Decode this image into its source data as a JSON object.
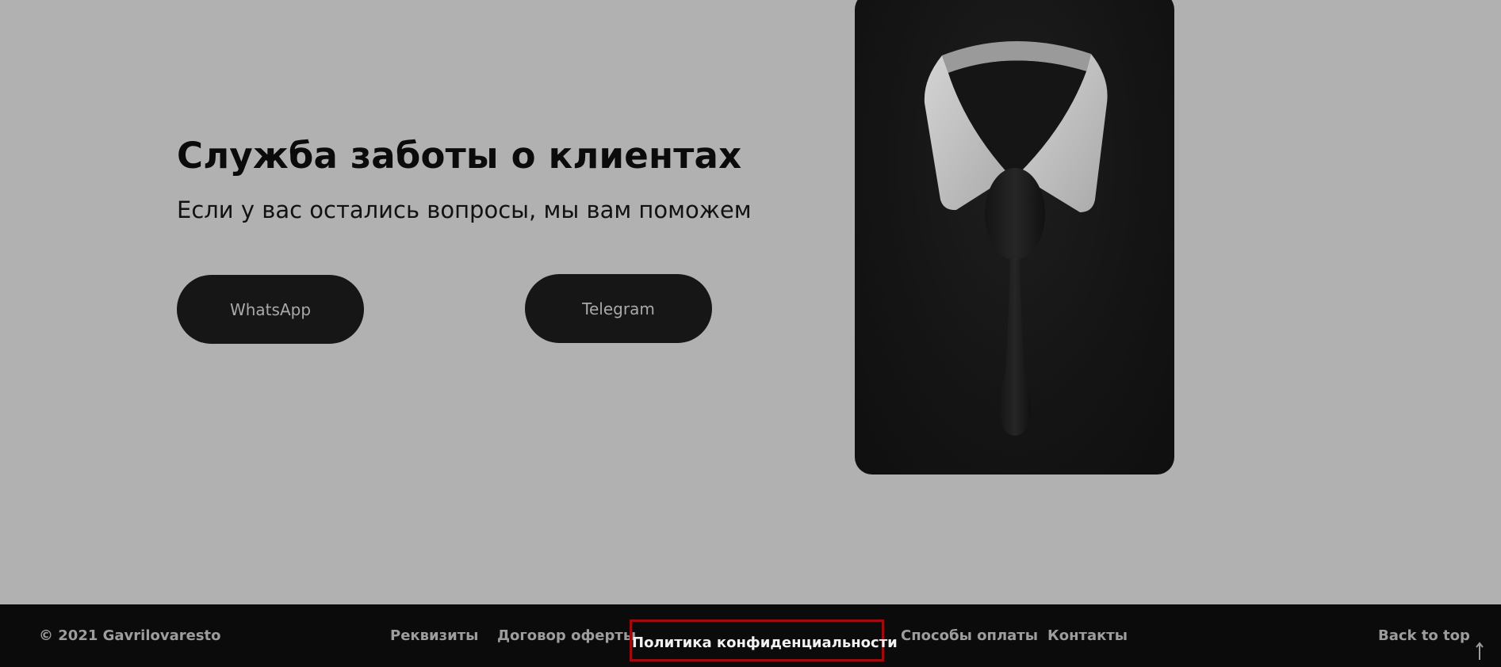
{
  "hero": {
    "title": "Служба заботы о клиентах",
    "subtitle": "Если у вас остались вопросы, мы вам поможем",
    "buttons": [
      {
        "label": "WhatsApp"
      },
      {
        "label": "Telegram"
      }
    ]
  },
  "photo": {
    "icon": "collar-spoon-illustration",
    "colors": {
      "background": "#141414",
      "collar": "#c8c8c8",
      "spoon": "#1c1c1c"
    }
  },
  "footer": {
    "copyright": "© 2021 Gavrilovaresto",
    "links": [
      {
        "label": "Реквизиты"
      },
      {
        "label": "Договор оферты"
      },
      {
        "label": "Политика конфиденциальности"
      },
      {
        "label": "Способы оплаты"
      },
      {
        "label": "Контакты"
      }
    ],
    "back_to_top": "Back to top",
    "highlight_color": "#9e0a0d"
  },
  "colors": {
    "page_background": "#b1b1b1",
    "button_background": "#161616",
    "footer_background": "#0b0b0b"
  }
}
